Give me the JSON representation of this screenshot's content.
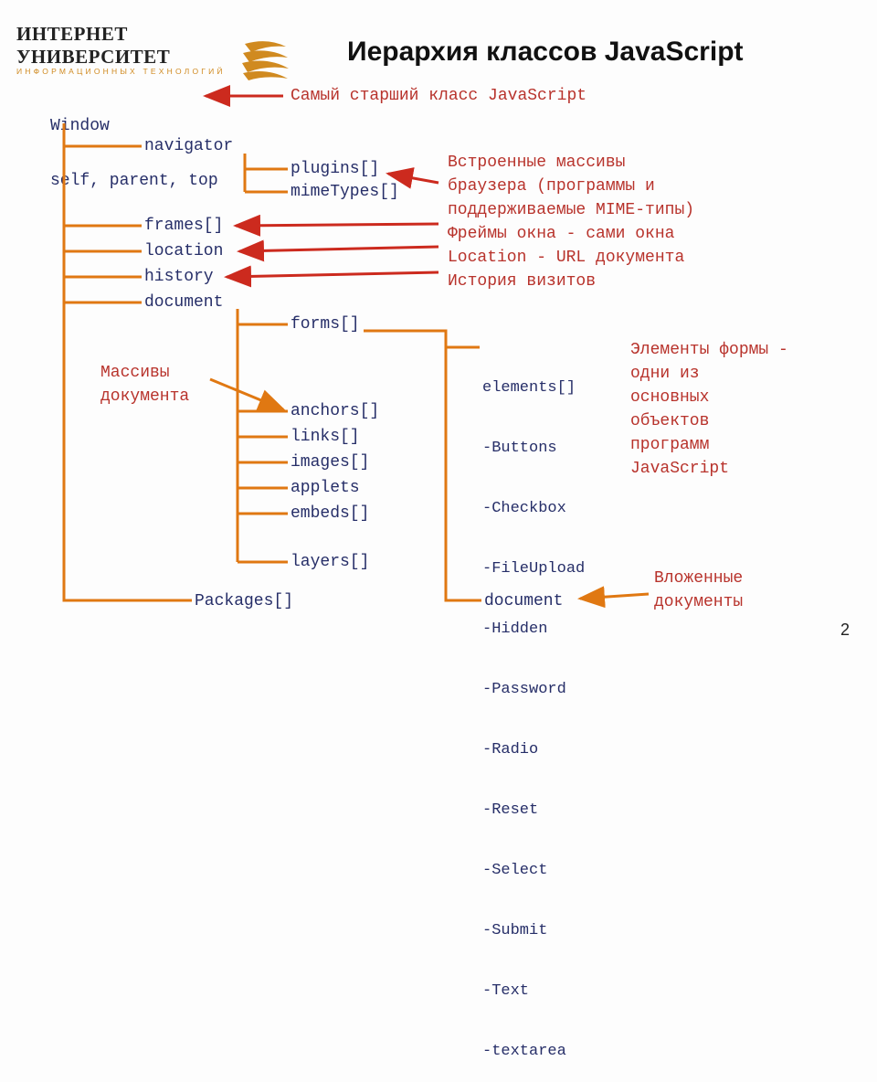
{
  "logo": {
    "line1": "ИНТЕРНЕТ УНИВЕРСИТЕТ",
    "line2": "ИНФОРМАЦИОННЫХ ТЕХНОЛОГИЙ"
  },
  "title": "Иерархия классов JavaScript",
  "root": {
    "line1": "Window",
    "line2": "self, parent, top"
  },
  "ann": {
    "root": "Самый старший класс JavaScript",
    "browser": "Встроенные массивы\nбраузера (программы и\nподдерживаемые MIME-типы)\nФреймы окна - сами окна\nLocation - URL документа\nИстория визитов",
    "form": "Элементы формы -\nодни из\nосновных\nобъектов\nпрограмм\nJavaScript",
    "nested": "Вложенные\nдокументы",
    "docarr": "Массивы\nдокумента"
  },
  "nav": {
    "label": "navigator",
    "children": [
      "plugins[]",
      "mimeTypes[]"
    ]
  },
  "win_children": [
    "frames[]",
    "location",
    "history",
    "document"
  ],
  "forms": "forms[]",
  "doc_children": [
    "anchors[]",
    "links[]",
    "images[]",
    "applets",
    "embeds[]"
  ],
  "layers": "layers[]",
  "packages": "Packages[]",
  "elements": {
    "head": "elements[]",
    "items": [
      "Buttons",
      "Checkbox",
      "FileUpload",
      "Hidden",
      "Password",
      "Radio",
      "Reset",
      "Select",
      "Submit",
      "Text",
      "textarea"
    ]
  },
  "layers_doc": "document",
  "pagenum": "2"
}
